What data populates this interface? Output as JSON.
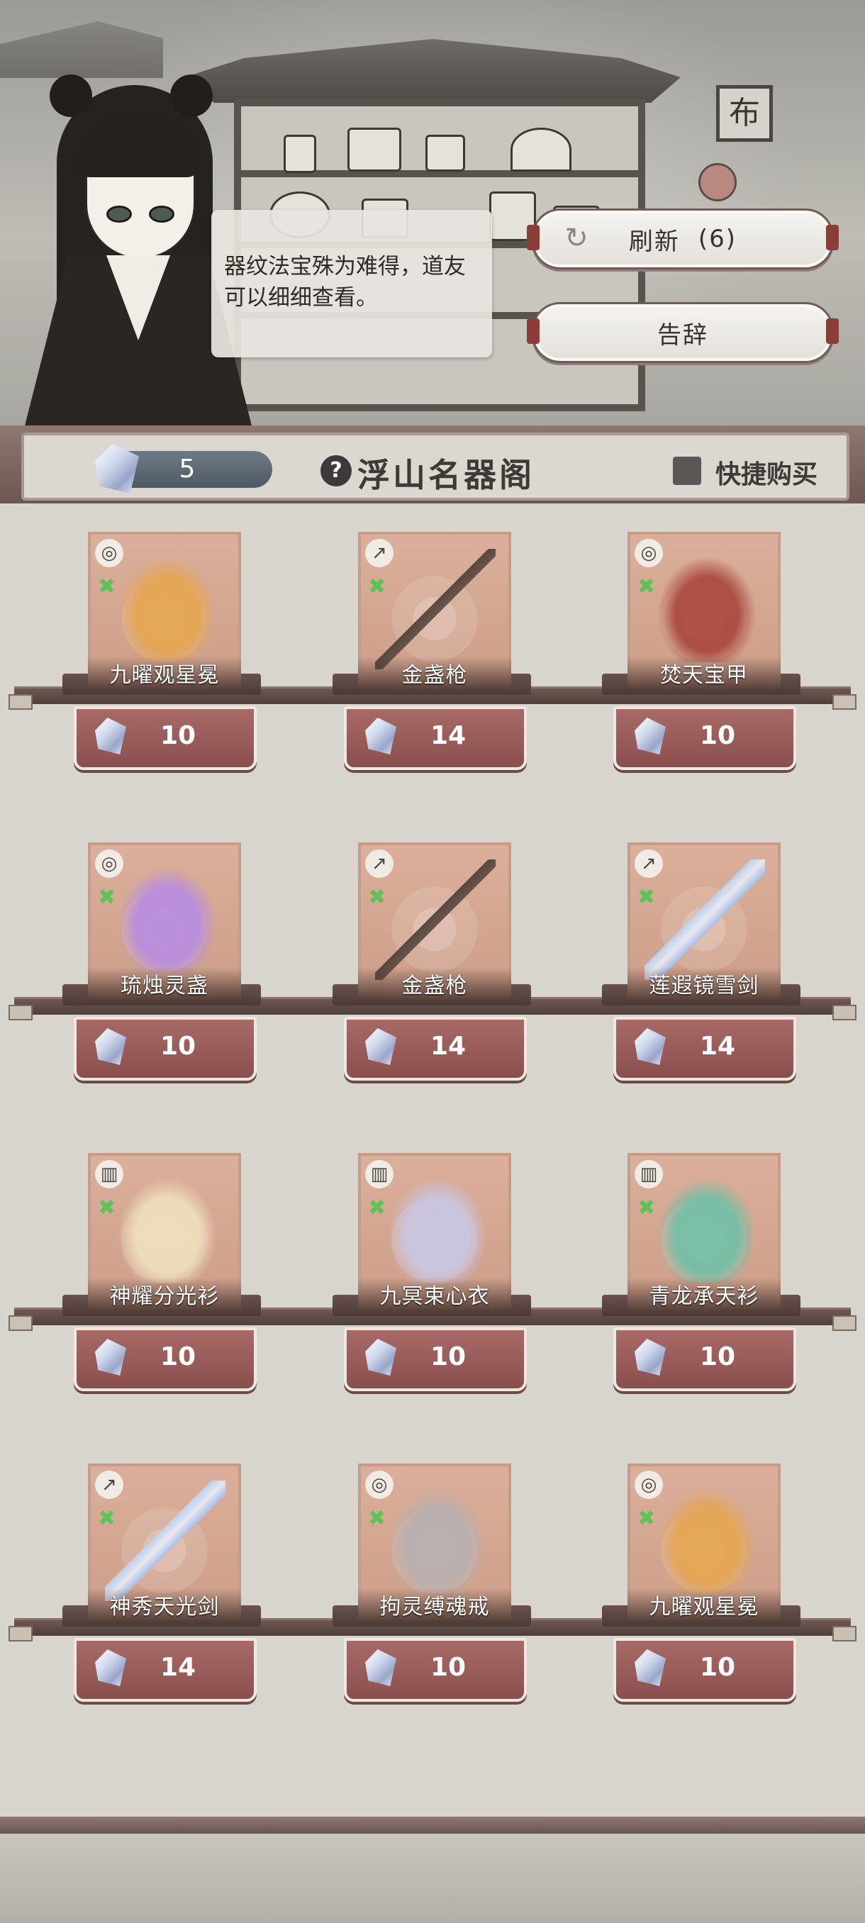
{
  "dialog": {
    "text": "器纹法宝殊为难得，道友可以细细查看。"
  },
  "buttons": {
    "refresh_label": "刷新",
    "refresh_count": "(6)",
    "leave_label": "告辞"
  },
  "scene": {
    "signboard": "布"
  },
  "header": {
    "currency_amount": "5",
    "help_symbol": "?",
    "shop_title": "浮山名器阁",
    "quick_buy_label": "快捷购买",
    "quick_buy_checked": false
  },
  "items": [
    {
      "name": "九曜观星冕",
      "price": "10",
      "slot_icon": "ring-icon",
      "art": "crown",
      "color": "#e5a54f"
    },
    {
      "name": "金盏枪",
      "price": "14",
      "slot_icon": "weapon-icon",
      "art": "spear",
      "color": "#5d4a40"
    },
    {
      "name": "焚天宝甲",
      "price": "10",
      "slot_icon": "ring-icon",
      "art": "armor",
      "color": "#a8463a"
    },
    {
      "name": "琉烛灵盏",
      "price": "10",
      "slot_icon": "ring-icon",
      "art": "lamp",
      "color": "#b78be0"
    },
    {
      "name": "金盏枪",
      "price": "14",
      "slot_icon": "weapon-icon",
      "art": "spear",
      "color": "#5d4a40"
    },
    {
      "name": "莲遐镜雪剑",
      "price": "14",
      "slot_icon": "weapon-icon",
      "art": "sword",
      "color": "#c7d7f1"
    },
    {
      "name": "神耀分光衫",
      "price": "10",
      "slot_icon": "armor-icon",
      "art": "robe",
      "color": "#efe0bd"
    },
    {
      "name": "九冥束心衣",
      "price": "10",
      "slot_icon": "armor-icon",
      "art": "robe",
      "color": "#c9c6e4"
    },
    {
      "name": "青龙承天衫",
      "price": "10",
      "slot_icon": "armor-icon",
      "art": "robe",
      "color": "#6fbfa6"
    },
    {
      "name": "神秀天光剑",
      "price": "14",
      "slot_icon": "weapon-icon",
      "art": "sword",
      "color": "#e5d59a"
    },
    {
      "name": "拘灵缚魂戒",
      "price": "10",
      "slot_icon": "ring-icon",
      "art": "ring",
      "color": "#b7aeb0"
    },
    {
      "name": "九曜观星冕",
      "price": "10",
      "slot_icon": "ring-icon",
      "art": "crown",
      "color": "#e5a54f"
    }
  ]
}
